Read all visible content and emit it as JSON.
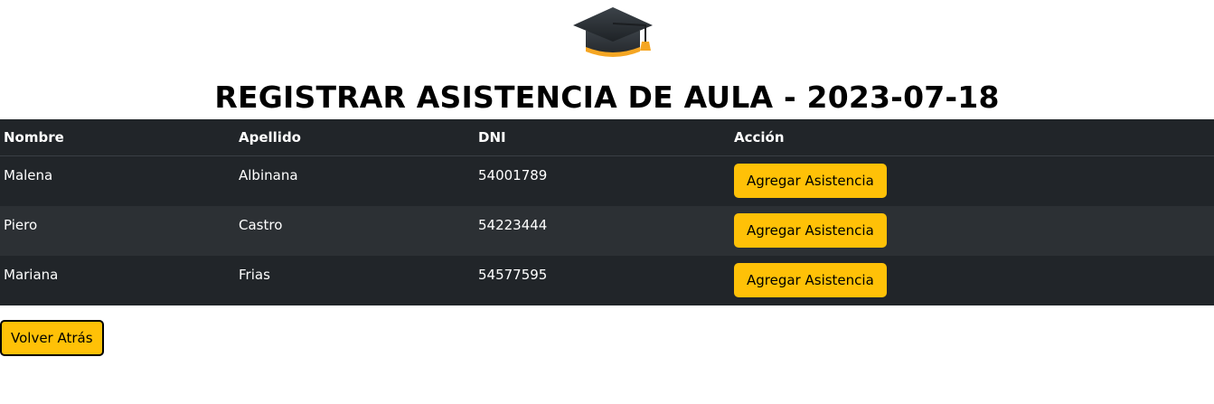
{
  "header": {
    "logo_icon": "graduation-cap-icon",
    "title": "REGISTRAR ASISTENCIA DE AULA - 2023-07-18"
  },
  "table": {
    "columns": [
      "Nombre",
      "Apellido",
      "DNI",
      "Acción"
    ],
    "rows": [
      {
        "nombre": "Malena",
        "apellido": "Albinana",
        "dni": "54001789",
        "action_label": "Agregar Asistencia"
      },
      {
        "nombre": "Piero",
        "apellido": "Castro",
        "dni": "54223444",
        "action_label": "Agregar Asistencia"
      },
      {
        "nombre": "Mariana",
        "apellido": "Frias",
        "dni": "54577595",
        "action_label": "Agregar Asistencia"
      }
    ]
  },
  "footer": {
    "back_label": "Volver Atrás"
  },
  "colors": {
    "table_bg": "#212529",
    "table_striped": "#2c3034",
    "button_warning": "#ffc107",
    "cap_tassel": "#f5a623"
  }
}
